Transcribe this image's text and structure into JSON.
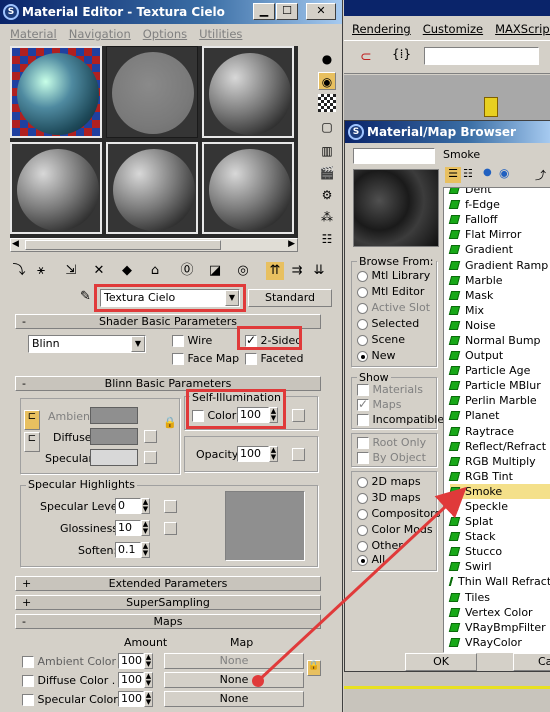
{
  "material_editor": {
    "title": "Material Editor - Textura Cielo",
    "menu": [
      "Material",
      "Navigation",
      "Options",
      "Utilities"
    ],
    "material_name": "Textura Cielo",
    "material_type": "Standard",
    "shader_basic": {
      "header": "Shader Basic Parameters",
      "shader": "Blinn",
      "wire": "Wire",
      "two_sided": "2-Sided",
      "face_map": "Face Map",
      "faceted": "Faceted"
    },
    "blinn_basic": {
      "header": "Blinn Basic Parameters",
      "self_illum_label": "Self-Illumination",
      "color_label": "Color",
      "self_illum_value": "100",
      "ambient": "Ambient:",
      "diffuse": "Diffuse:",
      "specular": "Specular:",
      "opacity_label": "Opacity:",
      "opacity_value": "100"
    },
    "specular_highlights": {
      "label": "Specular Highlights",
      "level_label": "Specular Level:",
      "level_value": "0",
      "gloss_label": "Glossiness:",
      "gloss_value": "10",
      "soften_label": "Soften:",
      "soften_value": "0.1"
    },
    "rollouts": {
      "extended": "Extended Parameters",
      "supersampling": "SuperSampling",
      "maps": "Maps"
    },
    "maps": {
      "amount_header": "Amount",
      "map_header": "Map",
      "rows": [
        {
          "label": "Ambient Color . .",
          "amount": "100",
          "map": "None"
        },
        {
          "label": "Diffuse Color . . .",
          "amount": "100",
          "map": "None"
        },
        {
          "label": "Specular Color .",
          "amount": "100",
          "map": "None"
        }
      ]
    }
  },
  "max_main": {
    "menu": [
      "Rendering",
      "Customize",
      "MAXScript"
    ]
  },
  "browser": {
    "title": "Material/Map Browser",
    "search_value": "Smoke",
    "browse_from_label": "Browse From:",
    "browse_from": [
      "Mtl Library",
      "Mtl Editor",
      "Active Slot",
      "Selected",
      "Scene",
      "New"
    ],
    "show_label": "Show",
    "show": [
      "Materials",
      "Maps",
      "Incompatible"
    ],
    "root_only": "Root Only",
    "by_object": "By Object",
    "map_types": [
      "2D maps",
      "3D maps",
      "Compositors",
      "Color Mods",
      "Other",
      "All"
    ],
    "items": [
      "Dent",
      "f-Edge",
      "Falloff",
      "Flat Mirror",
      "Gradient",
      "Gradient Ramp",
      "Marble",
      "Mask",
      "Mix",
      "Noise",
      "Normal Bump",
      "Output",
      "Particle Age",
      "Particle MBlur",
      "Perlin Marble",
      "Planet",
      "Raytrace",
      "Reflect/Refract",
      "RGB Multiply",
      "RGB Tint",
      "Smoke",
      "Speckle",
      "Splat",
      "Stack",
      "Stucco",
      "Swirl",
      "Thin Wall Refraction",
      "Tiles",
      "Vertex Color",
      "VRayBmpFilter",
      "VRayColor"
    ],
    "ok": "OK",
    "cancel": "Cancel"
  },
  "colors": {
    "highlight_red": "#e03a3a",
    "selected_item": "#f4e08a",
    "map_icon_green": "#18a818"
  }
}
